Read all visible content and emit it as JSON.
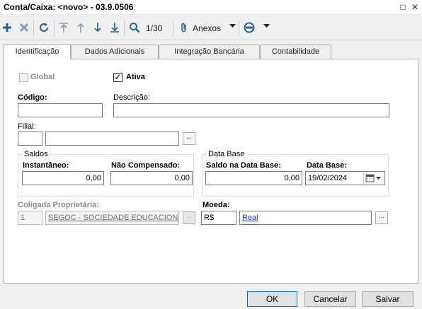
{
  "window": {
    "title": "Conta/Caixa: <novo> - 03.9.0506",
    "restore_glyph": "□",
    "close_glyph": "✕"
  },
  "toolbar": {
    "record_counter": "1/30",
    "attachments_label": "Anexos",
    "icons": [
      "add-icon",
      "delete-icon",
      "refresh-icon",
      "first-icon",
      "previous-icon",
      "next-icon",
      "last-icon",
      "search-icon",
      "paperclip-icon",
      "dropdown-arrow-icon",
      "options-icon",
      "dropdown-arrow-icon"
    ],
    "accent_color": "#1f5fa8"
  },
  "tabs": [
    {
      "label": "Identificação",
      "active": true
    },
    {
      "label": "Dados Adicionais",
      "active": false
    },
    {
      "label": "Integração Bancária",
      "active": false
    },
    {
      "label": "Contabilidade",
      "active": false
    }
  ],
  "form": {
    "global": {
      "label": "Global",
      "checked": false,
      "enabled": false
    },
    "ativa": {
      "label": "Ativa",
      "checked": true,
      "check_glyph": "✓"
    },
    "codigo": {
      "label": "Código:",
      "value": ""
    },
    "descricao": {
      "label": "Descrição:",
      "value": ""
    },
    "filial": {
      "label": "Filial:",
      "code": "",
      "name": "",
      "lookup_label": "..."
    },
    "saldos": {
      "title": "Saldos",
      "instantaneo": {
        "label": "Instantâneo:",
        "value": "0,00"
      },
      "nao_compensado": {
        "label": "Não Compensado:",
        "value": "0,00"
      }
    },
    "data_base": {
      "title": "Data Base",
      "saldo": {
        "label": "Saldo na Data Base:",
        "value": "0,00"
      },
      "data": {
        "label": "Data Base:",
        "value": "19/02/2024"
      }
    },
    "coligada": {
      "label": "Coligada Proprietária:",
      "code": "1",
      "name": "SEGOC - SOCIEDADE EDUCACIONAL",
      "lookup_label": "..."
    },
    "moeda": {
      "label": "Moeda:",
      "code": "R$",
      "name": "Real",
      "lookup_label": "..."
    }
  },
  "buttons": {
    "ok": "OK",
    "cancelar": "Cancelar",
    "salvar": "Salvar"
  }
}
